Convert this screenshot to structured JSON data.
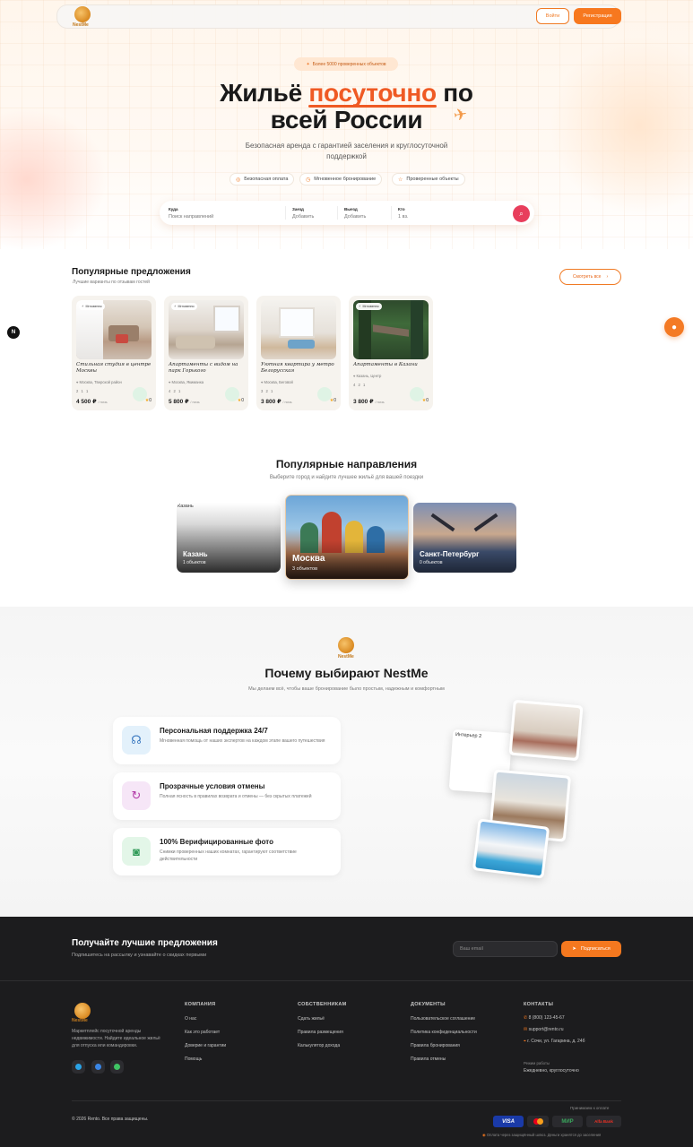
{
  "header": {
    "brand": "NestMe",
    "login": "Войти",
    "register": "Регистрация"
  },
  "hero": {
    "badge": "Более 5000 проверенных объектов",
    "title_part1": "Жильё ",
    "title_highlight": "посуточно",
    "title_part2": " по",
    "title_line2": "всей России",
    "subtitle": "Безопасная аренда с гарантией заселения и круглосуточной поддержкой",
    "features": [
      "Безопасная оплата",
      "Мгновенное бронирование",
      "Проверенные объекты"
    ]
  },
  "search": {
    "where_label": "Куда",
    "where_placeholder": "Поиск направлений",
    "checkin_label": "Заезд",
    "checkin_value": "Добавить",
    "checkout_label": "Выезд",
    "checkout_value": "Добавить",
    "guests_label": "Кто",
    "guests_value": "1 вз."
  },
  "offers": {
    "title": "Популярные предложения",
    "subtitle": "Лучшие варианты по отзывам гостей",
    "see_all": "Смотреть все",
    "badge": "Мгновенно",
    "items": [
      {
        "title": "Стильная студия в центре Москвы",
        "location": "Москва, Тверской район",
        "meta": "2  1  1",
        "price": "4 500 ₽",
        "per": "/ ночь",
        "rating": "0"
      },
      {
        "title": "Апартаменты с видом на парк Горького",
        "location": "Москва, Якиманка",
        "meta": "4  2  1",
        "price": "5 800 ₽",
        "per": "/ ночь",
        "rating": "0"
      },
      {
        "title": "Уютная квартира у метро Белорусская",
        "location": "Москва, Беговой",
        "meta": "3  2  1",
        "price": "3 800 ₽",
        "per": "/ ночь",
        "rating": "0"
      },
      {
        "title": "Апартаменты в Казани",
        "location": "Казань, Центр",
        "meta": "4  2  1",
        "price": "3 800 ₽",
        "per": "/ ночь",
        "rating": "0"
      }
    ]
  },
  "destinations": {
    "title": "Популярные направления",
    "subtitle": "Выберите город и найдите лучшее жильё для вашей поездки",
    "items": [
      {
        "alt": "Казань",
        "name": "Казань",
        "count": "1 объектов"
      },
      {
        "name": "Москва",
        "count": "3 объектов"
      },
      {
        "name": "Санкт-Петербург",
        "count": "0 объектов"
      }
    ]
  },
  "why": {
    "brand": "NestMe",
    "title": "Почему выбирают NestMe",
    "subtitle": "Мы делаем всё, чтобы ваше бронирование было простым, надежным и комфортным",
    "items": [
      {
        "title": "Персональная поддержка 24/7",
        "desc": "Мгновенная помощь от наших экспертов на каждом этапе вашего путешествия"
      },
      {
        "title": "Прозрачные условия отмены",
        "desc": "Полная ясность в правилах возврата и отмены — без скрытых платежей"
      },
      {
        "title": "100% Верифицированные фото",
        "desc": "Снимки проверенных наших комнатах, гарантируют соответствие действительности"
      }
    ],
    "photo_alt": "Интерьер 2"
  },
  "newsletter": {
    "title": "Получайте лучшие предложения",
    "subtitle": "Подпишитесь на рассылку и узнавайте о скидках первыми",
    "placeholder": "Ваш email",
    "button": "Подписаться"
  },
  "footer": {
    "brand": "NestMe",
    "about": "Маркетплейс посуточной аренды недвижимости. Найдите идеальное жильё для отпуска или командировки.",
    "company": {
      "title": "КОМПАНИЯ",
      "links": [
        "О нас",
        "Как это работает",
        "Доверие и гарантии",
        "Помощь"
      ]
    },
    "owners": {
      "title": "СОБСТВЕННИКАМ",
      "links": [
        "Сдать жильё",
        "Правила размещения",
        "Калькулятор дохода"
      ]
    },
    "docs": {
      "title": "ДОКУМЕНТЫ",
      "links": [
        "Пользовательское соглашение",
        "Политика конфиденциальности",
        "Правила бронирования",
        "Правила отмены"
      ]
    },
    "contacts": {
      "title": "КОНТАКТЫ",
      "phone": "8 (800) 123-45-67",
      "email": "support@rento.ru",
      "address": "г. Сочи, ул. Гагарина, д. 24б",
      "hours_label": "Режим работы",
      "hours": "Ежедневно, круглосуточно"
    },
    "copyright": "© 2026 Rento. Все права защищены.",
    "pay_label": "Принимаем к оплате",
    "pay_methods": [
      "VISA",
      "МИР",
      "Alfa Bank"
    ],
    "secure_note": "Оплата через защищённый шлюз. Деньги хранятся до заселения"
  },
  "colors": {
    "accent": "#f4781f",
    "highlight": "#ef5a24",
    "search_button": "#e83e5c",
    "footer_bg": "#1c1c1e"
  },
  "icons": [
    "logo-icon",
    "star-icon",
    "plane-icon",
    "shield-icon",
    "clock-icon",
    "search-icon",
    "chevron-right-icon",
    "chat-icon",
    "headset-icon",
    "refresh-icon",
    "camera-icon",
    "send-icon",
    "phone-icon",
    "mail-icon",
    "pin-icon",
    "telegram-icon",
    "whatsapp-icon"
  ]
}
